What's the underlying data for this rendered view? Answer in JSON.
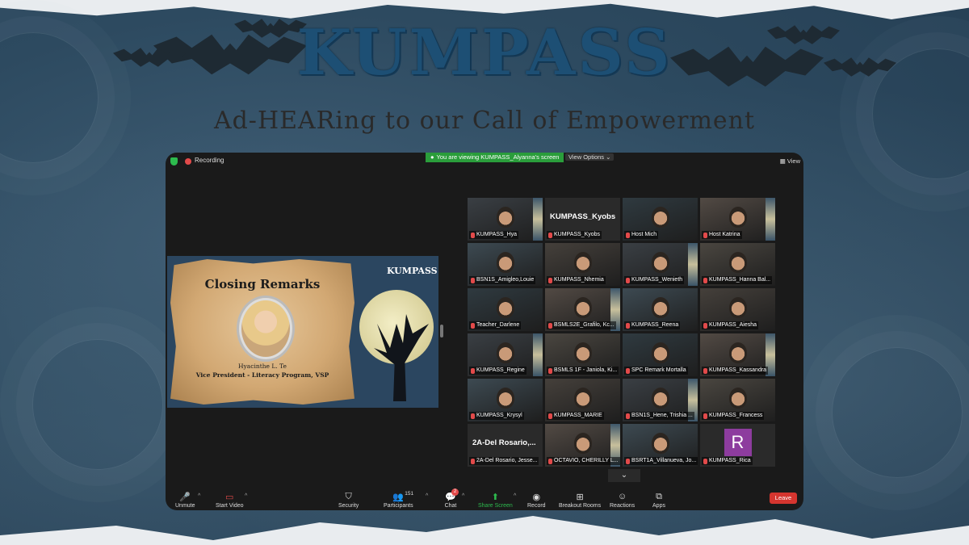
{
  "banner": {
    "title": "KUMPASS",
    "subtitle": "Ad-HEARing to our Call of Empowerment"
  },
  "topbar": {
    "recording_label": "Recording",
    "viewing_label": "You are viewing KUMPASS_Alyanna's screen",
    "view_options_label": "View Options ⌄",
    "view_label": "View"
  },
  "slide": {
    "title": "Closing Remarks",
    "speaker": "Hyacinthe L. Te",
    "role": "Vice President - Literacy Program, VSP",
    "brand": "KUMPASS"
  },
  "participants": [
    {
      "name": "KUMPASS_Hya",
      "video": true,
      "active": true
    },
    {
      "name": "KUMPASS_Kyobs",
      "video": false,
      "display": "KUMPASS_Kyobs"
    },
    {
      "name": "Host Mich",
      "video": true
    },
    {
      "name": "Host Katrina",
      "video": true
    },
    {
      "name": "BSN1S_Amigleo,Louie",
      "video": true
    },
    {
      "name": "KUMPASS_Nhemia",
      "video": true
    },
    {
      "name": "KUMPASS_Wenieth",
      "video": true
    },
    {
      "name": "KUMPASS_Hanna Bal...",
      "video": true
    },
    {
      "name": "Teacher_Darlene",
      "video": true
    },
    {
      "name": "BSMLS2E_Grafilo, Kc...",
      "video": true
    },
    {
      "name": "KUMPASS_Reena",
      "video": true
    },
    {
      "name": "KUMPASS_Aiesha",
      "video": true
    },
    {
      "name": "KUMPASS_Regine",
      "video": true
    },
    {
      "name": "BSMLS 1F - Janiola, Ki...",
      "video": true
    },
    {
      "name": "SPC Remark Mortalla",
      "video": true
    },
    {
      "name": "KUMPASS_Kassandra",
      "video": true
    },
    {
      "name": "KUMPASS_Krysyl",
      "video": true
    },
    {
      "name": "KUMPASS_MARIE",
      "video": true
    },
    {
      "name": "BSN1S_Hene, Trishia ...",
      "video": true
    },
    {
      "name": "KUMPASS_Francess",
      "video": true
    },
    {
      "name": "2A-Del Rosario, Jesse...",
      "video": false,
      "display": "2A-Del Rosario,..."
    },
    {
      "name": "OCTAVIO, CHERILLY L...",
      "video": true
    },
    {
      "name": "BSRT1A_Villanueva, Jo...",
      "video": true
    },
    {
      "name": "KUMPASS_Rica",
      "video": false,
      "avatar": "R"
    }
  ],
  "toolbar": {
    "unmute": "Unmute",
    "start_video": "Start Video",
    "security": "Security",
    "participants": "Participants",
    "participant_count": "151",
    "chat": "Chat",
    "chat_badge": "2",
    "share_screen": "Share Screen",
    "record": "Record",
    "breakout_rooms": "Breakout Rooms",
    "reactions": "Reactions",
    "apps": "Apps",
    "leave": "Leave"
  },
  "colors": {
    "accent_green": "#2dbb4e",
    "leave_red": "#d5352f",
    "active_outline": "#d9d36a"
  }
}
